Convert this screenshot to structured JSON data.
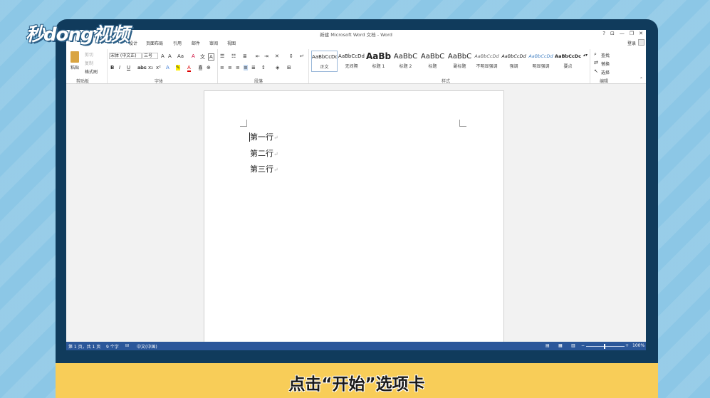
{
  "watermark": {
    "logo_text": "秒dong视频"
  },
  "window": {
    "title": "新建 Microsoft Word 文档 - Word",
    "controls": [
      "?",
      "⊡",
      "—",
      "❐",
      "✕"
    ]
  },
  "tabs": [
    "设计",
    "页面布局",
    "引用",
    "邮件",
    "审阅",
    "视图"
  ],
  "account": {
    "login": "登录"
  },
  "ribbon": {
    "clipboard": {
      "paste": "粘贴",
      "cut": "剪切",
      "copy": "复制",
      "format_painter": "格式刷",
      "group": "剪贴板"
    },
    "font": {
      "name": "宋体 (中文正)",
      "size": "三号",
      "group": "字体"
    },
    "paragraph": {
      "group": "段落"
    },
    "styles": {
      "group": "样式",
      "items": [
        {
          "sample": "AaBbCcDd",
          "name": "正文"
        },
        {
          "sample": "AaBbCcDd",
          "name": "无间隔"
        },
        {
          "sample": "AaBb",
          "name": "标题 1"
        },
        {
          "sample": "AaBbC",
          "name": "标题 2"
        },
        {
          "sample": "AaBbC",
          "name": "标题"
        },
        {
          "sample": "AaBbC",
          "name": "副标题"
        },
        {
          "sample": "AaBbCcDd",
          "name": "不明显强调"
        },
        {
          "sample": "AaBbCcDd",
          "name": "强调"
        },
        {
          "sample": "AaBbCcDd",
          "name": "明显强调"
        },
        {
          "sample": "AaBbCcDc",
          "name": "要点"
        }
      ]
    },
    "editing": {
      "find": "查找",
      "replace": "替换",
      "select": "选择",
      "group": "编辑"
    }
  },
  "document": {
    "lines": [
      "第一行",
      "第二行",
      "第三行"
    ],
    "para_mark": "↵"
  },
  "status": {
    "page": "第 1 页，共 1 页",
    "words": "9 个字",
    "lang": "中文(中国)",
    "zoom": "100%"
  },
  "caption": "点击“开始”选项卡",
  "colors": {
    "statusbar": "#2b579a",
    "caption_bg": "#f8cd58",
    "bezel": "#103b5c"
  }
}
